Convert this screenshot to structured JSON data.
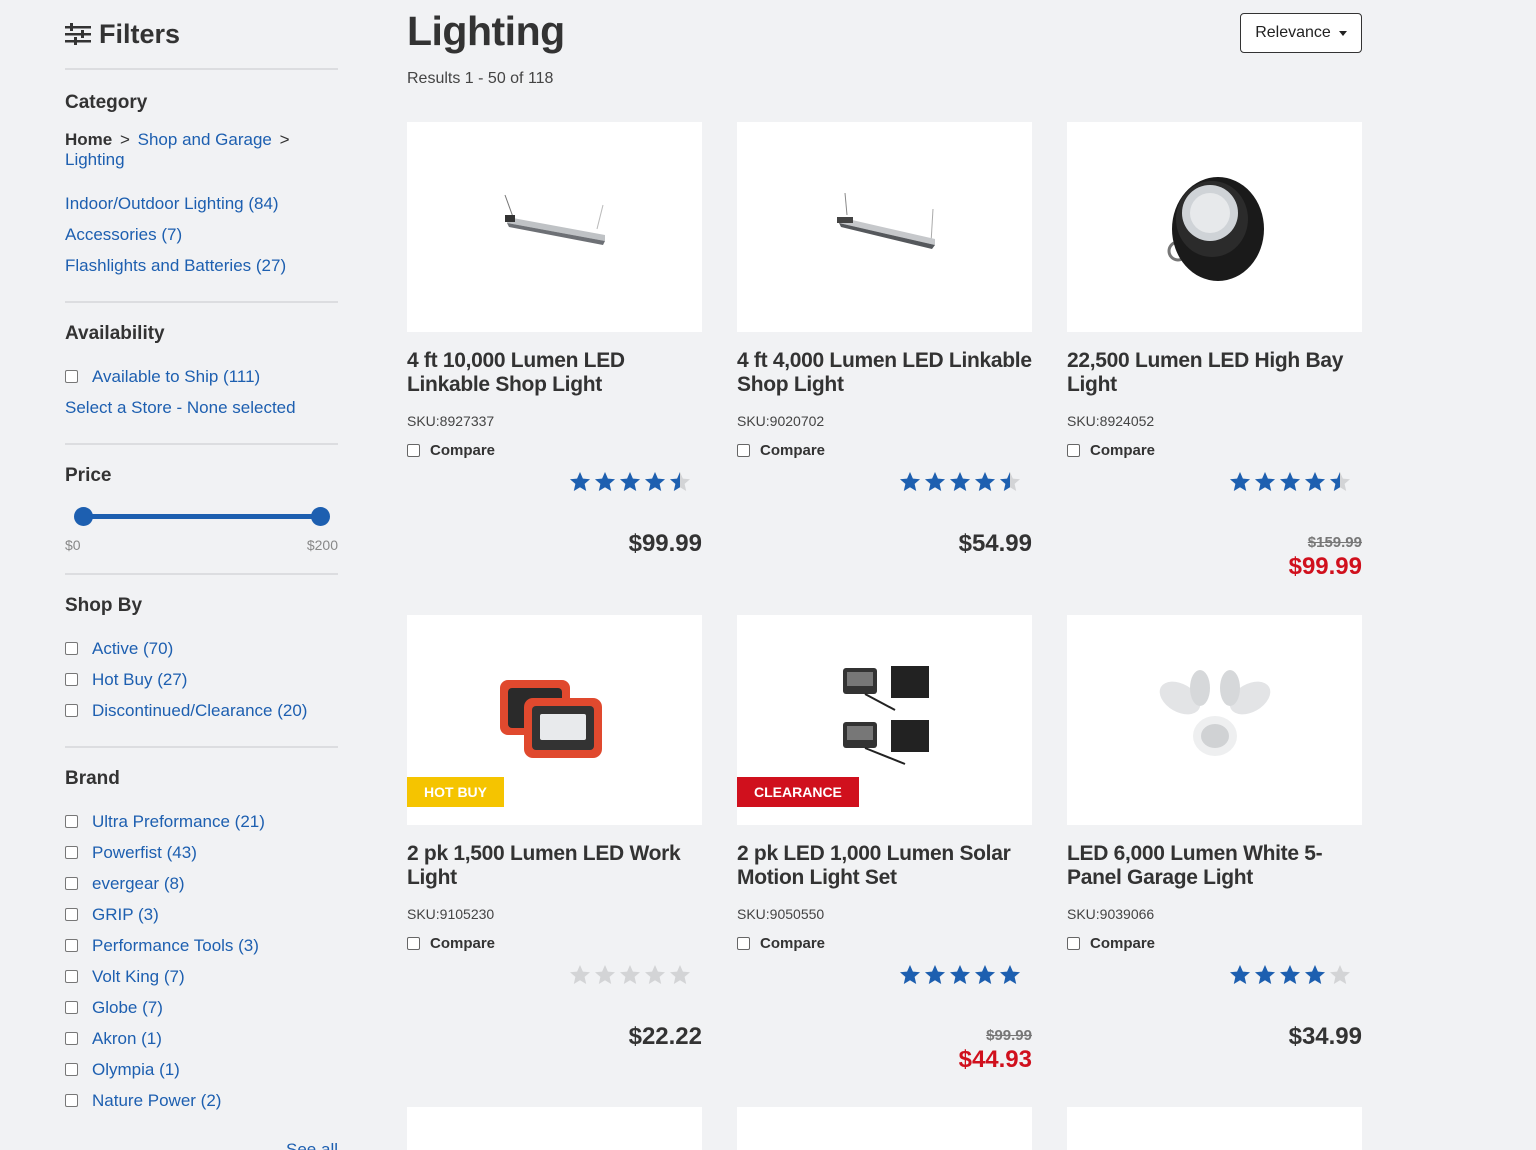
{
  "sidebar": {
    "filters_title": "Filters",
    "category": {
      "heading": "Category",
      "breadcrumb": {
        "home": "Home",
        "sep": ">",
        "level1": "Shop and Garage",
        "level2": "Lighting"
      },
      "links": [
        "Indoor/Outdoor Lighting (84)",
        "Accessories (7)",
        "Flashlights and Batteries (27)"
      ]
    },
    "availability": {
      "heading": "Availability",
      "option": "Available to Ship (111)",
      "store_link": "Select a Store - None selected"
    },
    "price": {
      "heading": "Price",
      "min_label": "$0",
      "max_label": "$200",
      "range": [
        0,
        200
      ],
      "selected": [
        0,
        200
      ]
    },
    "shop_by": {
      "heading": "Shop By",
      "options": [
        "Active (70)",
        "Hot Buy (27)",
        "Discontinued/Clearance (20)"
      ]
    },
    "brand": {
      "heading": "Brand",
      "options": [
        "Ultra Preformance (21)",
        "Powerfist (43)",
        "evergear (8)",
        "GRIP (3)",
        "Performance Tools (3)",
        "Volt King (7)",
        "Globe (7)",
        "Akron (1)",
        "Olympia (1)",
        "Nature Power (2)"
      ],
      "see_all": "See all"
    }
  },
  "main": {
    "title": "Lighting",
    "results": "Results 1 - 50 of 118",
    "sort_label": "Relevance",
    "compare_label": "Compare",
    "products": [
      {
        "name": "4 ft 10,000 Lumen LED Linkable Shop Light",
        "sku": "SKU:8927337",
        "rating": 4.5,
        "price": "$99.99",
        "old_price": "",
        "badge": ""
      },
      {
        "name": "4 ft 4,000 Lumen LED Linkable Shop Light",
        "sku": "SKU:9020702",
        "rating": 4.5,
        "price": "$54.99",
        "old_price": "",
        "badge": ""
      },
      {
        "name": "22,500 Lumen LED High Bay Light",
        "sku": "SKU:8924052",
        "rating": 4.5,
        "price": "$99.99",
        "old_price": "$159.99",
        "badge": ""
      },
      {
        "name": "2 pk 1,500 Lumen LED Work Light",
        "sku": "SKU:9105230",
        "rating": 0,
        "price": "$22.22",
        "old_price": "",
        "badge": "HOT BUY"
      },
      {
        "name": "2 pk LED 1,000 Lumen Solar Motion Light Set",
        "sku": "SKU:9050550",
        "rating": 5,
        "price": "$44.93",
        "old_price": "$99.99",
        "badge": "CLEARANCE"
      },
      {
        "name": "LED 6,000 Lumen White 5-Panel Garage Light",
        "sku": "SKU:9039066",
        "rating": 4,
        "price": "$34.99",
        "old_price": "",
        "badge": ""
      }
    ]
  },
  "colors": {
    "link": "#1d5fb0",
    "star": "#1d5fb0",
    "sale": "#d0101d",
    "hot_buy": "#f5c400",
    "clearance": "#d0101d"
  }
}
